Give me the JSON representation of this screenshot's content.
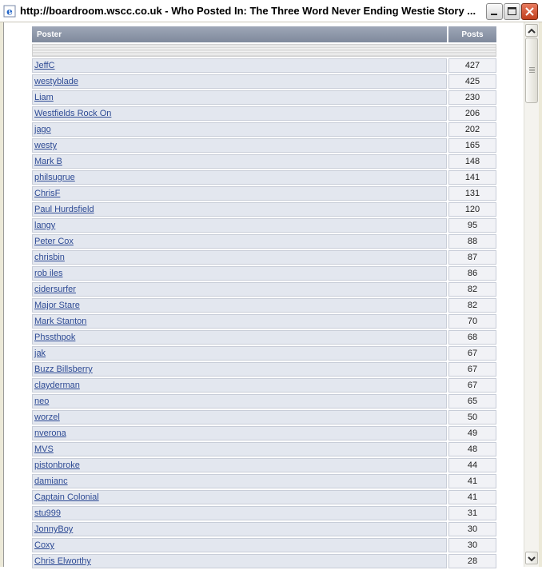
{
  "window": {
    "title": "http://boardroom.wscc.co.uk - Who Posted In: The Three Word Never Ending Westie Story ..."
  },
  "table": {
    "headers": {
      "poster": "Poster",
      "posts": "Posts"
    },
    "rows": [
      {
        "name": "JeffC",
        "posts": "427"
      },
      {
        "name": "westyblade",
        "posts": "425"
      },
      {
        "name": "Liam",
        "posts": "230"
      },
      {
        "name": "Westfields Rock On",
        "posts": "206"
      },
      {
        "name": "jago",
        "posts": "202"
      },
      {
        "name": "westy",
        "posts": "165"
      },
      {
        "name": "Mark B",
        "posts": "148"
      },
      {
        "name": "philsugrue",
        "posts": "141"
      },
      {
        "name": "ChrisF",
        "posts": "131"
      },
      {
        "name": "Paul Hurdsfield",
        "posts": "120"
      },
      {
        "name": "langy",
        "posts": "95"
      },
      {
        "name": "Peter Cox",
        "posts": "88"
      },
      {
        "name": "chrisbin",
        "posts": "87"
      },
      {
        "name": "rob iles",
        "posts": "86"
      },
      {
        "name": "cidersurfer",
        "posts": "82"
      },
      {
        "name": "Major Stare",
        "posts": "82"
      },
      {
        "name": "Mark Stanton",
        "posts": "70"
      },
      {
        "name": "Phssthpok",
        "posts": "68"
      },
      {
        "name": "jak",
        "posts": "67"
      },
      {
        "name": "Buzz Billsberry",
        "posts": "67"
      },
      {
        "name": "clayderman",
        "posts": "67"
      },
      {
        "name": "neo",
        "posts": "65"
      },
      {
        "name": "worzel",
        "posts": "50"
      },
      {
        "name": "nverona",
        "posts": "49"
      },
      {
        "name": "MVS",
        "posts": "48"
      },
      {
        "name": "pistonbroke",
        "posts": "44"
      },
      {
        "name": "damianc",
        "posts": "41"
      },
      {
        "name": "Captain Colonial",
        "posts": "41"
      },
      {
        "name": "stu999",
        "posts": "31"
      },
      {
        "name": "JonnyBoy",
        "posts": "30"
      },
      {
        "name": "Coxy",
        "posts": "30"
      },
      {
        "name": "Chris Elworthy",
        "posts": "28"
      }
    ]
  }
}
